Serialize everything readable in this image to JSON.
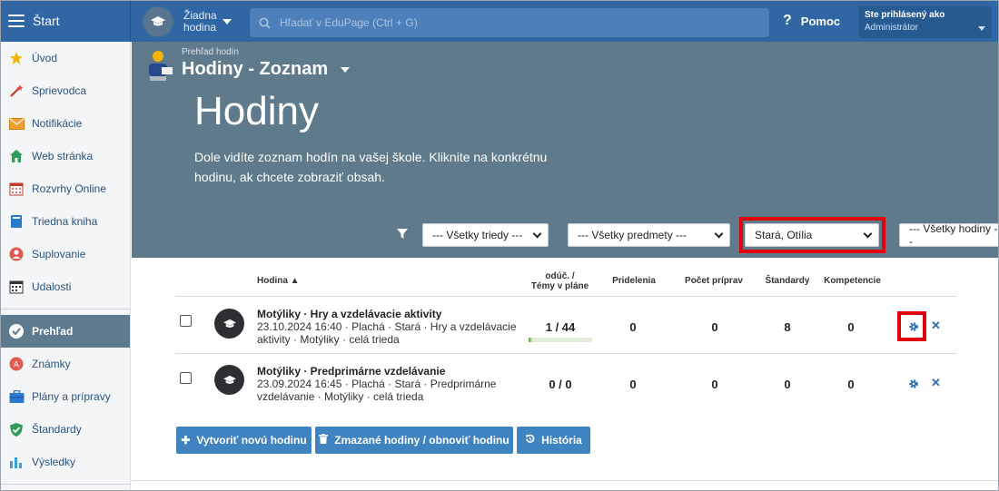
{
  "topbar": {
    "menu_label": "Štart",
    "lesson_line1": "Žiadna",
    "lesson_line2": "hodina",
    "search_placeholder": "Hľadať v EduPage (Ctrl + G)",
    "help_label": "Pomoc",
    "user_line1": "Ste prihlásený ako",
    "user_line2": "Administrátor"
  },
  "sidebar": {
    "items": [
      {
        "label": "Úvod",
        "icon": "star-icon"
      },
      {
        "label": "Sprievodca",
        "icon": "magic-wand-icon"
      },
      {
        "label": "Notifikácie",
        "icon": "envelope-icon"
      },
      {
        "label": "Web stránka",
        "icon": "house-icon"
      },
      {
        "label": "Rozvrhy Online",
        "icon": "calendar-grid-icon"
      },
      {
        "label": "Triedna kniha",
        "icon": "book-icon"
      },
      {
        "label": "Suplovanie",
        "icon": "person-icon"
      },
      {
        "label": "Udalosti",
        "icon": "calendar-icon"
      },
      {
        "label": "Prehľad",
        "icon": "check-circle-icon"
      },
      {
        "label": "Známky",
        "icon": "grade-icon"
      },
      {
        "label": "Plány a prípravy",
        "icon": "briefcase-icon"
      },
      {
        "label": "Štandardy",
        "icon": "shield-check-icon"
      },
      {
        "label": "Výsledky",
        "icon": "bar-chart-icon"
      }
    ]
  },
  "header": {
    "breadcrumb": "Prehľad hodín",
    "page_title": "Hodiny - Zoznam",
    "hero": "Hodiny",
    "description": "Dole vidíte zoznam hodín na vašej škole. Kliknite na konkrétnu hodinu, ak chcete zobraziť obsah."
  },
  "filters": {
    "classes": "--- Všetky triedy ---",
    "subjects": "--- Všetky predmety ---",
    "teacher": "Stará, Otília",
    "lessons": "--- Všetky hodiny ---"
  },
  "table": {
    "headers": {
      "lesson": "Hodina ▲",
      "taught_line1": "odúč. /",
      "taught_line2": "Témy v pláne",
      "assignments": "Pridelenia",
      "preparations": "Počet príprav",
      "standards": "Štandardy",
      "competences": "Kompetencie"
    },
    "rows": [
      {
        "title": "Motýliky · Hry a vzdelávacie aktivity",
        "meta_line1": "23.10.2024 16:40 · Plachá · Stará · Hry a vzdelávacie",
        "meta_line2": "aktivity · Motýliky · celá trieda",
        "taught": "1 / 44",
        "progress": 0.023,
        "assignments": "0",
        "preparations": "0",
        "standards": "8",
        "competences": "0"
      },
      {
        "title": "Motýliky · Predprimárne vzdelávanie",
        "meta_line1": "23.09.2024 16:45 · Plachá · Stará · Predprimárne",
        "meta_line2": "vzdelávanie · Motýliky · celá trieda",
        "taught": "0 / 0",
        "assignments": "0",
        "preparations": "0",
        "standards": "0",
        "competences": "0"
      }
    ]
  },
  "buttons": {
    "create": "Vytvoriť novú hodinu",
    "deleted": "Zmazané hodiny / obnoviť hodinu",
    "history": "História"
  },
  "colors": {
    "topbar": "#2f66a3",
    "header": "#5f7b8b",
    "highlight": "#e0000e",
    "button": "#3f83c0",
    "active_nav": "#5d7a8f"
  }
}
